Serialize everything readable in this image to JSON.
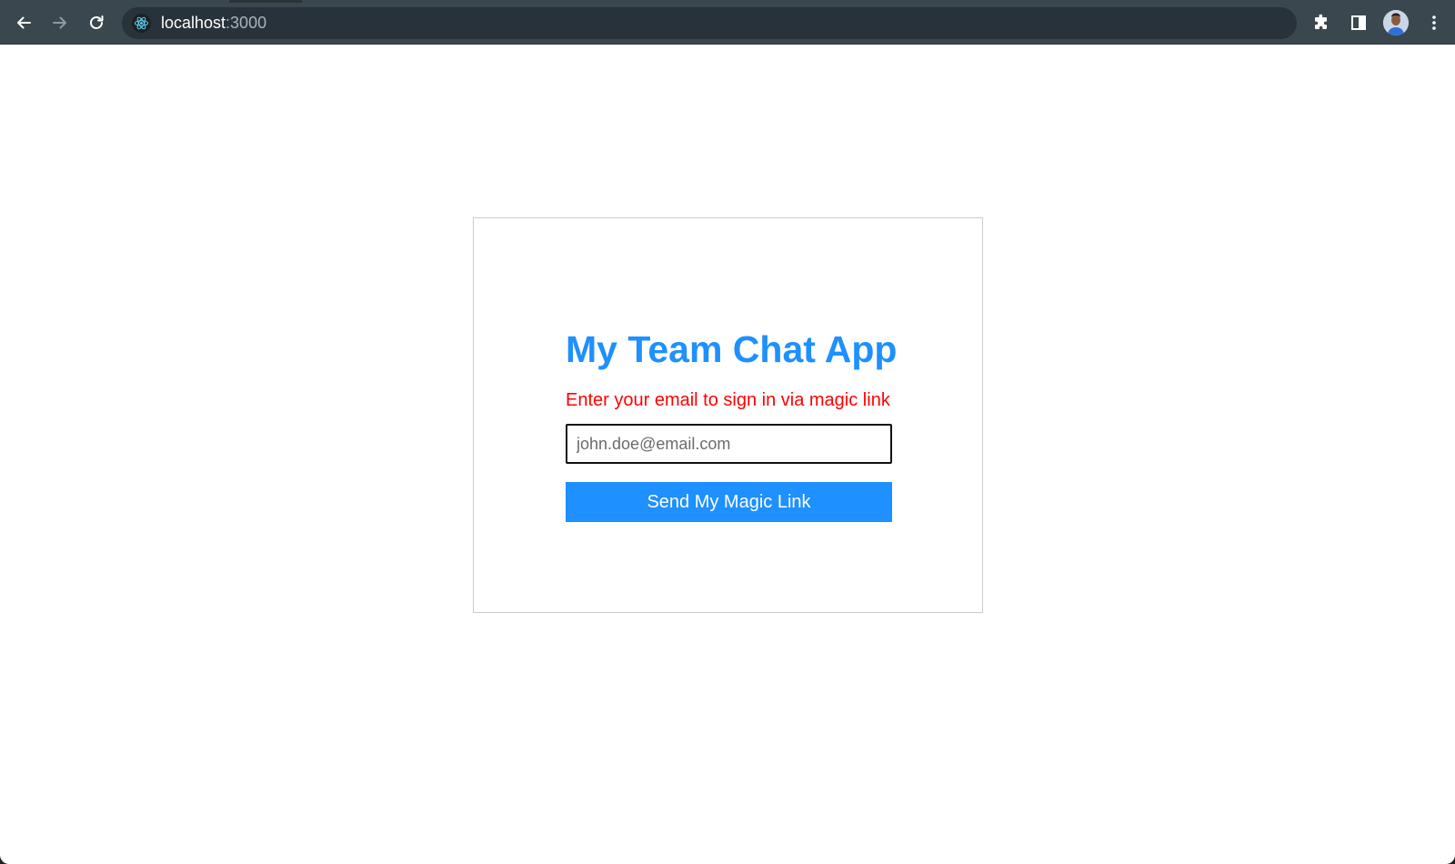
{
  "browser": {
    "url_host": "localhost",
    "url_port": ":3000",
    "site_icon": "react-logo-icon",
    "toolbar_color": "#3b474f",
    "omnibox_color": "#28323a"
  },
  "page": {
    "title": "My Team Chat App",
    "subtitle": "Enter your email to sign in via magic link",
    "email_placeholder": "john.doe@email.com",
    "email_value": "",
    "submit_label": "Send My Magic Link",
    "colors": {
      "accent": "#1e90ff",
      "subtitle": "#ff0000",
      "card_border": "#cccccc"
    }
  }
}
